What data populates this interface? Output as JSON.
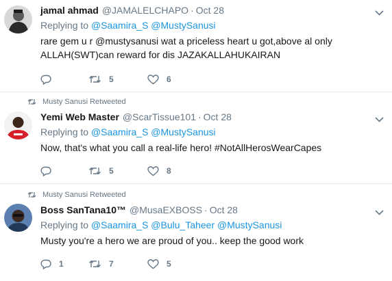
{
  "tweets": [
    {
      "name": "jamal ahmad",
      "handle": "@JAMALELCHAPO",
      "time": "Oct 28",
      "replying_prefix": "Replying to",
      "reply_to": [
        "@Saamira_S",
        "@MustySanusi"
      ],
      "text_lines": [
        "rare gem u r @mustysanusi  wat a priceless heart u got,above al only",
        "ALLAH(SWT)can reward for dis JAZAKALLAHUKAIRAN"
      ],
      "replies": "",
      "retweets": "5",
      "likes": "6"
    },
    {
      "retweeted_by": "Musty Sanusi Retweeted",
      "name": "Yemi Web Master",
      "handle": "@ScarTissue101",
      "time": "Oct 28",
      "replying_prefix": "Replying to",
      "reply_to": [
        "@Saamira_S",
        "@MustySanusi"
      ],
      "text_lines": [
        "Now, that's what you call a real-life hero! #NotAllHerosWearCapes"
      ],
      "replies": "",
      "retweets": "5",
      "likes": "8"
    },
    {
      "retweeted_by": "Musty Sanusi Retweeted",
      "name": "Boss SanTana10™",
      "handle": "@MusaEXBOSS",
      "time": "Oct 28",
      "replying_prefix": "Replying to",
      "reply_to": [
        "@Saamira_S",
        "@Bulu_Taheer",
        "@MustySanusi"
      ],
      "text_lines": [
        "Musty you're a hero we are proud of you.. keep the good work"
      ],
      "replies": "1",
      "retweets": "7",
      "likes": "5"
    }
  ],
  "colors": {
    "text": "#14171a",
    "muted": "#657786",
    "link": "#1b95e0",
    "divider": "#e6ecf0"
  }
}
